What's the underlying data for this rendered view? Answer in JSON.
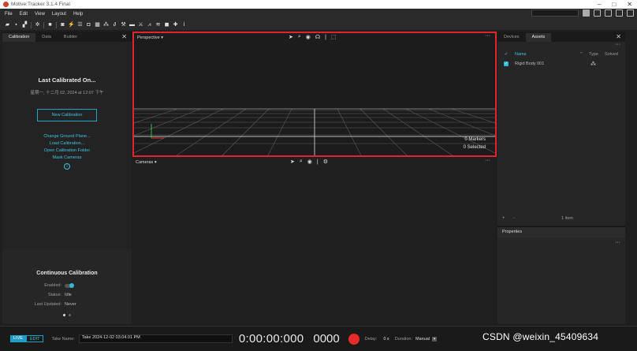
{
  "window": {
    "title": "Motive:Tracker 3.1.4 Final"
  },
  "menu": {
    "items": [
      "File",
      "Edit",
      "View",
      "Layout",
      "Help"
    ]
  },
  "left_panel": {
    "tabs": [
      "Calibration",
      "Data",
      "Builder"
    ],
    "active_tab": "Calibration",
    "close_glyph": "✕",
    "calibration": {
      "title": "Last Calibrated On...",
      "date": "星期一, 十二月 02, 2024 at 12:07 下午",
      "new_button": "New Calibration",
      "links": [
        "Change Ground Plane...",
        "Load Calibration...",
        "Open Calibration Folder",
        "Mask Cameras"
      ],
      "info_icon": "info-icon"
    },
    "continuous": {
      "title": "Continuous Calibration",
      "enabled_label": "Enabled:",
      "status_label": "Status:",
      "status_value": "Idle",
      "last_updated_label": "Last Updated:",
      "last_updated_value": "Never"
    }
  },
  "perspective": {
    "title": "Perspective ▾",
    "markers": "0 Markers",
    "selected": "0 Selected",
    "more": "···"
  },
  "cameras": {
    "title": "Cameras ▾",
    "more": "···"
  },
  "right_panel": {
    "tabs": [
      "Devices",
      "Assets"
    ],
    "active_tab": "Assets",
    "close_glyph": "✕",
    "more": "···",
    "columns": {
      "check": "✔",
      "name": "Name",
      "sort": "⌃",
      "type": "Type",
      "solved": "Solved"
    },
    "assets": [
      {
        "name": "Rigid Body 001",
        "type_icon": "⁂",
        "checked": "✓"
      }
    ],
    "footer": {
      "add": "+",
      "remove": "−",
      "count": "1 item"
    }
  },
  "properties": {
    "title": "Properties",
    "more": "···"
  },
  "timeline": {
    "live": "LIVE",
    "edit": "EDIT",
    "take_label": "Take Name:",
    "take_name": "Take 2024-12-02 03.04.01 PM",
    "timecode": "0:00:00:000",
    "frame": "0000",
    "delay_label": "Delay:",
    "delay_value": "0 s",
    "duration_label": "Duration:",
    "duration_value": "Manual"
  },
  "watermark": "CSDN @weixin_45409634",
  "colors": {
    "accent": "#2fb9d8",
    "record": "#e52b2b",
    "highlight_border": "#e0262b"
  }
}
